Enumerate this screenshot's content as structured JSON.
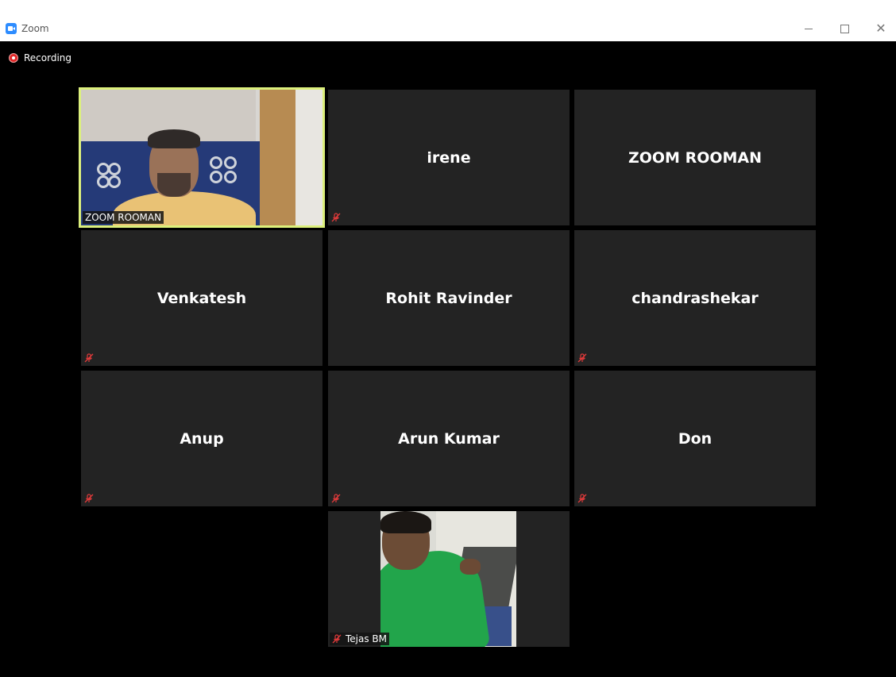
{
  "window": {
    "title": "Zoom",
    "accent": "#2D8CFF"
  },
  "recording": {
    "label": "Recording",
    "color": "#e02828"
  },
  "participants": [
    {
      "name": "ZOOM ROOMAN",
      "video": true,
      "muted": false,
      "active_speaker": true
    },
    {
      "name": "irene",
      "video": false,
      "muted": true
    },
    {
      "name": "ZOOM ROOMAN",
      "video": false,
      "muted": false
    },
    {
      "name": "Venkatesh",
      "video": false,
      "muted": true
    },
    {
      "name": "Rohit Ravinder",
      "video": false,
      "muted": false
    },
    {
      "name": "chandrashekar",
      "video": false,
      "muted": true
    },
    {
      "name": "Anup",
      "video": false,
      "muted": true
    },
    {
      "name": "Arun Kumar",
      "video": false,
      "muted": true
    },
    {
      "name": "Don",
      "video": false,
      "muted": true
    },
    {
      "name": "Tejas BM",
      "video": true,
      "muted": true
    }
  ],
  "colors": {
    "active_speaker_border": "#dcf07c",
    "tile_background": "#232323",
    "mute_icon": "#e03a3a"
  }
}
